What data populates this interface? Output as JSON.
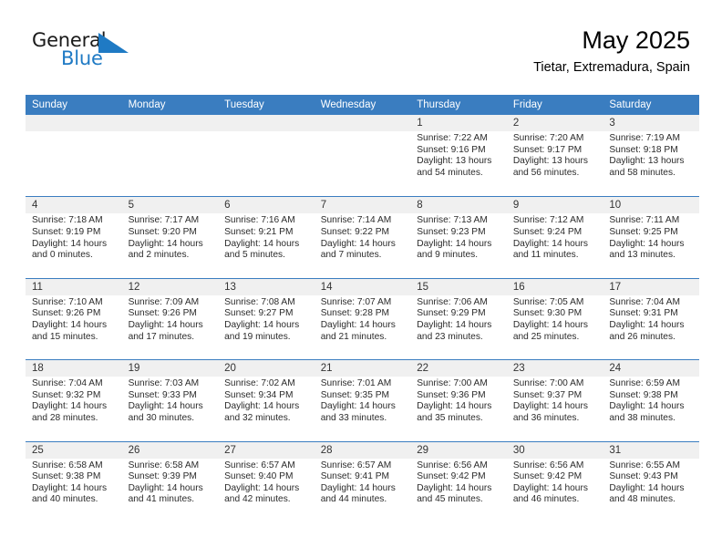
{
  "brand": {
    "name_line1": "General",
    "name_line2": "Blue",
    "mark_icon": "triangle-flag-icon",
    "accent_color": "#1f7ac4"
  },
  "header": {
    "month_title": "May 2025",
    "location": "Tietar, Extremadura, Spain"
  },
  "calendar": {
    "header_color": "#3a7dc0",
    "daynum_band_color": "#f0f0f0",
    "weekday_headers": [
      "Sunday",
      "Monday",
      "Tuesday",
      "Wednesday",
      "Thursday",
      "Friday",
      "Saturday"
    ],
    "weeks": [
      [
        {
          "day": "",
          "empty": true
        },
        {
          "day": "",
          "empty": true
        },
        {
          "day": "",
          "empty": true
        },
        {
          "day": "",
          "empty": true
        },
        {
          "day": "1",
          "sunrise": "Sunrise: 7:22 AM",
          "sunset": "Sunset: 9:16 PM",
          "daylight": "Daylight: 13 hours and 54 minutes."
        },
        {
          "day": "2",
          "sunrise": "Sunrise: 7:20 AM",
          "sunset": "Sunset: 9:17 PM",
          "daylight": "Daylight: 13 hours and 56 minutes."
        },
        {
          "day": "3",
          "sunrise": "Sunrise: 7:19 AM",
          "sunset": "Sunset: 9:18 PM",
          "daylight": "Daylight: 13 hours and 58 minutes."
        }
      ],
      [
        {
          "day": "4",
          "sunrise": "Sunrise: 7:18 AM",
          "sunset": "Sunset: 9:19 PM",
          "daylight": "Daylight: 14 hours and 0 minutes."
        },
        {
          "day": "5",
          "sunrise": "Sunrise: 7:17 AM",
          "sunset": "Sunset: 9:20 PM",
          "daylight": "Daylight: 14 hours and 2 minutes."
        },
        {
          "day": "6",
          "sunrise": "Sunrise: 7:16 AM",
          "sunset": "Sunset: 9:21 PM",
          "daylight": "Daylight: 14 hours and 5 minutes."
        },
        {
          "day": "7",
          "sunrise": "Sunrise: 7:14 AM",
          "sunset": "Sunset: 9:22 PM",
          "daylight": "Daylight: 14 hours and 7 minutes."
        },
        {
          "day": "8",
          "sunrise": "Sunrise: 7:13 AM",
          "sunset": "Sunset: 9:23 PM",
          "daylight": "Daylight: 14 hours and 9 minutes."
        },
        {
          "day": "9",
          "sunrise": "Sunrise: 7:12 AM",
          "sunset": "Sunset: 9:24 PM",
          "daylight": "Daylight: 14 hours and 11 minutes."
        },
        {
          "day": "10",
          "sunrise": "Sunrise: 7:11 AM",
          "sunset": "Sunset: 9:25 PM",
          "daylight": "Daylight: 14 hours and 13 minutes."
        }
      ],
      [
        {
          "day": "11",
          "sunrise": "Sunrise: 7:10 AM",
          "sunset": "Sunset: 9:26 PM",
          "daylight": "Daylight: 14 hours and 15 minutes."
        },
        {
          "day": "12",
          "sunrise": "Sunrise: 7:09 AM",
          "sunset": "Sunset: 9:26 PM",
          "daylight": "Daylight: 14 hours and 17 minutes."
        },
        {
          "day": "13",
          "sunrise": "Sunrise: 7:08 AM",
          "sunset": "Sunset: 9:27 PM",
          "daylight": "Daylight: 14 hours and 19 minutes."
        },
        {
          "day": "14",
          "sunrise": "Sunrise: 7:07 AM",
          "sunset": "Sunset: 9:28 PM",
          "daylight": "Daylight: 14 hours and 21 minutes."
        },
        {
          "day": "15",
          "sunrise": "Sunrise: 7:06 AM",
          "sunset": "Sunset: 9:29 PM",
          "daylight": "Daylight: 14 hours and 23 minutes."
        },
        {
          "day": "16",
          "sunrise": "Sunrise: 7:05 AM",
          "sunset": "Sunset: 9:30 PM",
          "daylight": "Daylight: 14 hours and 25 minutes."
        },
        {
          "day": "17",
          "sunrise": "Sunrise: 7:04 AM",
          "sunset": "Sunset: 9:31 PM",
          "daylight": "Daylight: 14 hours and 26 minutes."
        }
      ],
      [
        {
          "day": "18",
          "sunrise": "Sunrise: 7:04 AM",
          "sunset": "Sunset: 9:32 PM",
          "daylight": "Daylight: 14 hours and 28 minutes."
        },
        {
          "day": "19",
          "sunrise": "Sunrise: 7:03 AM",
          "sunset": "Sunset: 9:33 PM",
          "daylight": "Daylight: 14 hours and 30 minutes."
        },
        {
          "day": "20",
          "sunrise": "Sunrise: 7:02 AM",
          "sunset": "Sunset: 9:34 PM",
          "daylight": "Daylight: 14 hours and 32 minutes."
        },
        {
          "day": "21",
          "sunrise": "Sunrise: 7:01 AM",
          "sunset": "Sunset: 9:35 PM",
          "daylight": "Daylight: 14 hours and 33 minutes."
        },
        {
          "day": "22",
          "sunrise": "Sunrise: 7:00 AM",
          "sunset": "Sunset: 9:36 PM",
          "daylight": "Daylight: 14 hours and 35 minutes."
        },
        {
          "day": "23",
          "sunrise": "Sunrise: 7:00 AM",
          "sunset": "Sunset: 9:37 PM",
          "daylight": "Daylight: 14 hours and 36 minutes."
        },
        {
          "day": "24",
          "sunrise": "Sunrise: 6:59 AM",
          "sunset": "Sunset: 9:38 PM",
          "daylight": "Daylight: 14 hours and 38 minutes."
        }
      ],
      [
        {
          "day": "25",
          "sunrise": "Sunrise: 6:58 AM",
          "sunset": "Sunset: 9:38 PM",
          "daylight": "Daylight: 14 hours and 40 minutes."
        },
        {
          "day": "26",
          "sunrise": "Sunrise: 6:58 AM",
          "sunset": "Sunset: 9:39 PM",
          "daylight": "Daylight: 14 hours and 41 minutes."
        },
        {
          "day": "27",
          "sunrise": "Sunrise: 6:57 AM",
          "sunset": "Sunset: 9:40 PM",
          "daylight": "Daylight: 14 hours and 42 minutes."
        },
        {
          "day": "28",
          "sunrise": "Sunrise: 6:57 AM",
          "sunset": "Sunset: 9:41 PM",
          "daylight": "Daylight: 14 hours and 44 minutes."
        },
        {
          "day": "29",
          "sunrise": "Sunrise: 6:56 AM",
          "sunset": "Sunset: 9:42 PM",
          "daylight": "Daylight: 14 hours and 45 minutes."
        },
        {
          "day": "30",
          "sunrise": "Sunrise: 6:56 AM",
          "sunset": "Sunset: 9:42 PM",
          "daylight": "Daylight: 14 hours and 46 minutes."
        },
        {
          "day": "31",
          "sunrise": "Sunrise: 6:55 AM",
          "sunset": "Sunset: 9:43 PM",
          "daylight": "Daylight: 14 hours and 48 minutes."
        }
      ]
    ]
  }
}
